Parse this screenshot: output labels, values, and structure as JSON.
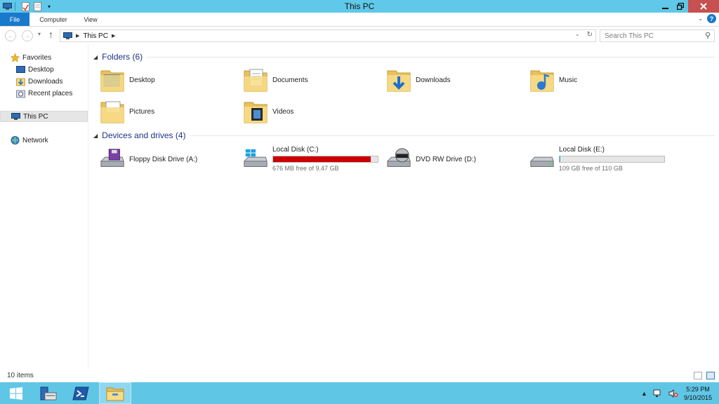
{
  "window": {
    "title": "This PC"
  },
  "ribbon": {
    "tabs": [
      "File",
      "Computer",
      "View"
    ],
    "help": "?"
  },
  "address": {
    "crumbs": [
      "This PC"
    ]
  },
  "search": {
    "placeholder": "Search This PC"
  },
  "sidebar": {
    "favorites": "Favorites",
    "favorite_items": [
      "Desktop",
      "Downloads",
      "Recent places"
    ],
    "this_pc": "This PC",
    "network": "Network"
  },
  "folders": {
    "header": "Folders (6)",
    "items": [
      "Desktop",
      "Documents",
      "Downloads",
      "Music",
      "Pictures",
      "Videos"
    ]
  },
  "devices": {
    "header": "Devices and drives (4)",
    "items": [
      {
        "name": "Floppy Disk Drive (A:)",
        "icon": "floppy-drive-icon"
      },
      {
        "name": "Local Disk (C:)",
        "free": "676 MB free of 9.47 GB",
        "used_fraction": 0.93,
        "bar_color": "#cc0000",
        "icon": "windows-drive-icon"
      },
      {
        "name": "DVD RW Drive (D:)",
        "icon": "dvd-drive-icon"
      },
      {
        "name": "Local Disk (E:)",
        "free": "109 GB free of 110 GB",
        "used_fraction": 0.01,
        "bar_color": "#26a0da",
        "icon": "hard-drive-icon"
      }
    ]
  },
  "status": {
    "items": "10 items"
  },
  "taskbar": {
    "time": "5:29 PM",
    "date": "9/10/2015"
  },
  "colors": {
    "titlebar": "#60c8e8",
    "file_tab": "#1979ca",
    "taskbar": "#60c6e6",
    "folder": "#f5d77a"
  }
}
